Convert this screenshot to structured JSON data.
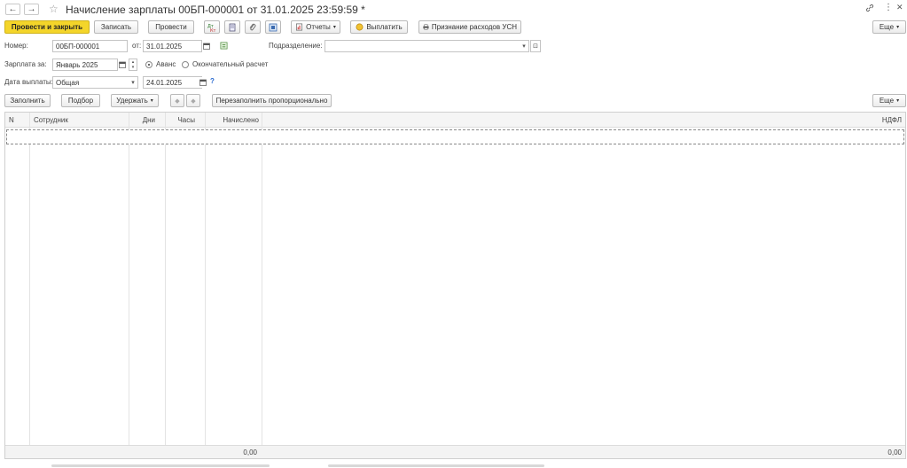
{
  "window": {
    "title": "Начисление зарплаты 00БП-000001 от 31.01.2025 23:59:59 *",
    "back_icon": "←",
    "forward_icon": "→",
    "star_icon": "☆",
    "link_icon": "🔗",
    "more_icon": "⋮",
    "close_icon": "✕"
  },
  "toolbar": {
    "post_and_close": "Провести и закрыть",
    "save": "Записать",
    "post": "Провести",
    "reports": "Отчеты",
    "pay": "Выплатить",
    "recognize_expenses": "Признание расходов УСН",
    "more": "Еще"
  },
  "form": {
    "number_label": "Номер:",
    "number_value": "00БП-000001",
    "date_label": "от:",
    "date_value": "31.01.2025",
    "department_label": "Подразделение:",
    "department_value": "",
    "salary_for_label": "Зарплата за:",
    "salary_for_value": "Январь 2025",
    "advance_label": "Аванс",
    "final_label": "Окончательный расчет",
    "payment_date_label": "Дата выплаты:",
    "payment_type_value": "Общая",
    "payment_date_value": "24.01.2025",
    "help": "?"
  },
  "table_toolbar": {
    "fill": "Заполнить",
    "select": "Подбор",
    "withhold": "Удержать",
    "refill": "Перезаполнить пропорционально",
    "more": "Еще"
  },
  "table": {
    "columns": [
      "N",
      "Сотрудник",
      "Дни",
      "Часы",
      "Начислено",
      "НДФЛ"
    ],
    "totals": {
      "accrued": "0,00",
      "ndfl": "0,00"
    }
  }
}
